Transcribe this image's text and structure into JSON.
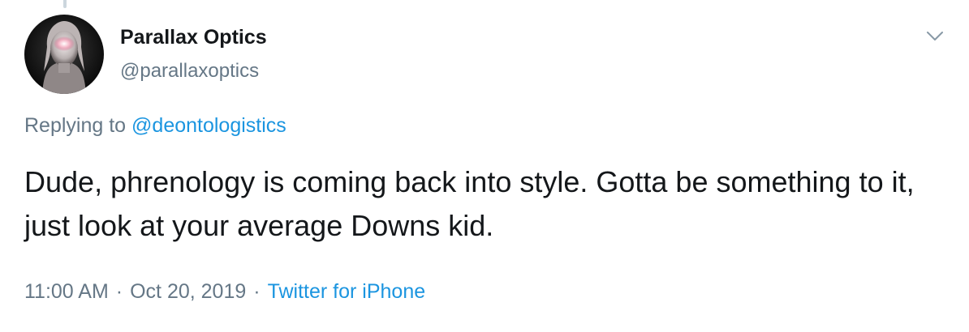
{
  "author": {
    "display_name": "Parallax Optics",
    "handle": "@parallaxoptics",
    "avatar_icon": "profile-avatar"
  },
  "reply": {
    "prefix": "Replying to ",
    "mention": "@deontologistics"
  },
  "tweet": {
    "text": "Dude, phrenology is coming back into style. Gotta be something to it, just look at your average Downs kid."
  },
  "meta": {
    "time": "11:00 AM",
    "separator": "·",
    "date": "Oct 20, 2019",
    "source": "Twitter for iPhone"
  },
  "menu": {
    "icon": "chevron-down-icon"
  },
  "colors": {
    "text": "#14171a",
    "secondary": "#657786",
    "link": "#1b95e0"
  }
}
